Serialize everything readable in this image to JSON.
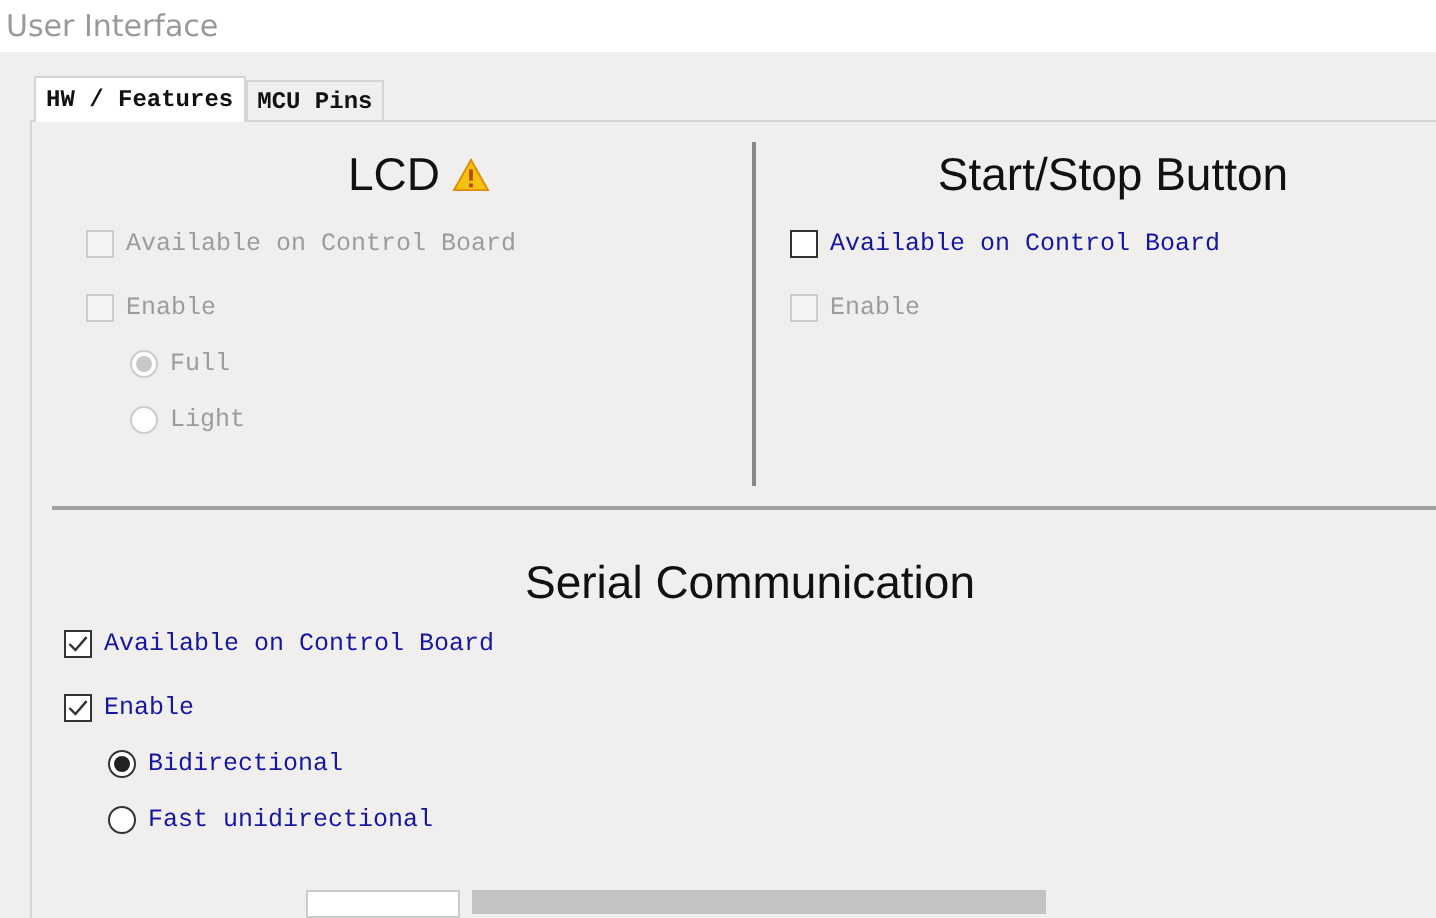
{
  "window": {
    "title": "User Interface"
  },
  "tabs": [
    {
      "label": "HW / Features",
      "selected": true
    },
    {
      "label": "MCU Pins",
      "selected": false
    }
  ],
  "top_sections": [
    {
      "title": "LCD",
      "warning": true,
      "items": [
        {
          "kind": "checkbox",
          "label": "Available on Control Board",
          "checked": false,
          "disabled": true
        },
        {
          "kind": "checkbox",
          "label": "Enable",
          "checked": false,
          "disabled": true
        },
        {
          "kind": "radio",
          "label": "Full",
          "selected": true,
          "disabled": true
        },
        {
          "kind": "radio",
          "label": "Light",
          "selected": false,
          "disabled": true
        }
      ]
    },
    {
      "title": "Start/Stop Button",
      "warning": false,
      "items": [
        {
          "kind": "checkbox",
          "label": "Available on Control Board",
          "checked": false,
          "disabled": false
        },
        {
          "kind": "checkbox",
          "label": "Enable",
          "checked": false,
          "disabled": true
        }
      ]
    }
  ],
  "serial_section": {
    "title": "Serial Communication",
    "warning": false,
    "items": [
      {
        "kind": "checkbox",
        "label": "Available on Control Board",
        "checked": true,
        "disabled": false
      },
      {
        "kind": "checkbox",
        "label": "Enable",
        "checked": true,
        "disabled": false
      },
      {
        "kind": "radio",
        "label": "Bidirectional",
        "selected": true,
        "disabled": false
      },
      {
        "kind": "radio",
        "label": "Fast unidirectional",
        "selected": false,
        "disabled": false
      }
    ]
  }
}
